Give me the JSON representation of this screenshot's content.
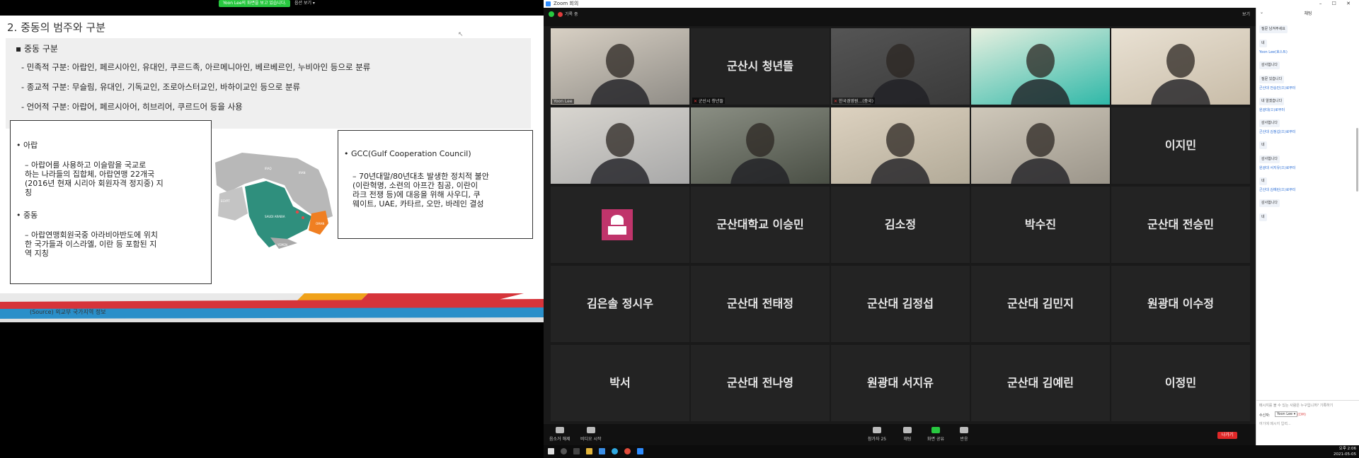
{
  "share_bar": {
    "sharing_text": "Yoon Lee의 화면을 보고 있습니다.",
    "view_options": "옵션 보기 ▾"
  },
  "slide": {
    "title": "2. 중동의 범주와 구분",
    "heading": "▪  중동 구분",
    "lines": [
      "- 민족적 구분: 아랍인, 페르시아인, 유대인, 쿠르드족, 아르메니아인, 베르베르인, 누비아인 등으로 분류",
      "- 종교적 구분: 무슬림, 유대인, 기독교인, 조로아스터교인, 바하이교인 등으로 분류",
      "- 언어적 구분:  아랍어, 페르시아어, 히브리어, 쿠르드어 등을 사용"
    ],
    "left_box": {
      "arab_title": "•  아랍",
      "arab_desc": [
        "– 아랍어를 사용하고 이슬람을 국교로",
        "하는 나라들의 집합체, 아랍연맹 22개국",
        "(2016년 현재 시리아 회원자격 정지중) 지",
        "칭"
      ],
      "me_title": "•  중동",
      "me_desc": [
        "– 아랍연맹회원국중 아라비아반도에 위치",
        "한 국가들과 이스라엘, 이란 등 포함된 지",
        "역 지칭"
      ]
    },
    "right_box": {
      "title": "•  GCC(Gulf Cooperation Council)",
      "desc": [
        "– 70년대말/80년대초 발생한 정치적 불안",
        "(이란혁명, 소련의 아프간 침공, 이란이",
        "라크 전쟁 등)에 대응을 위해 사우디, 쿠",
        "웨이트, UAE, 카타르, 오만, 바레인 결성"
      ]
    },
    "map_labels": {
      "turkey": "TURKEY",
      "iraq": "IRAQ",
      "iran": "IRAN",
      "egypt": "EGYPT",
      "saudi": "SAUDI ARABIA",
      "oman": "OMAN",
      "yemen": "YEMEN"
    },
    "source": "(Source) 외교부 국가지역 정보"
  },
  "zoom": {
    "window_title": "Zoom 회의",
    "window_controls": "–  ☐  ✕",
    "recording_label": "기록 중",
    "view_label": "보기",
    "tiles": [
      {
        "kind": "video",
        "label": "Yoon Lee"
      },
      {
        "kind": "name",
        "name": "군산시 청년뜰",
        "label": "군산시 청년뜰",
        "muted": true
      },
      {
        "kind": "video",
        "label": "한국경영원...(중국)",
        "muted": true
      },
      {
        "kind": "video",
        "label": "",
        "muted": true
      },
      {
        "kind": "video",
        "label": ""
      },
      {
        "kind": "video",
        "label": ""
      },
      {
        "kind": "video",
        "label": ""
      },
      {
        "kind": "video",
        "label": ""
      },
      {
        "kind": "video",
        "label": ""
      },
      {
        "kind": "name",
        "name": "이지민",
        "label": ""
      },
      {
        "kind": "avatar",
        "label": ""
      },
      {
        "kind": "name",
        "name": "군산대학교 이승민",
        "label": ""
      },
      {
        "kind": "name",
        "name": "김소정",
        "label": ""
      },
      {
        "kind": "name",
        "name": "박수진",
        "label": ""
      },
      {
        "kind": "name",
        "name": "군산대 전승민",
        "label": ""
      },
      {
        "kind": "name",
        "name": "김은솔 정시우",
        "label": ""
      },
      {
        "kind": "name",
        "name": "군산대 전태정",
        "label": ""
      },
      {
        "kind": "name",
        "name": "군산대 김정섭",
        "label": ""
      },
      {
        "kind": "name",
        "name": "군산대 김민지",
        "label": ""
      },
      {
        "kind": "name",
        "name": "원광대 이수정",
        "label": ""
      },
      {
        "kind": "name",
        "name": "박서",
        "label": ""
      },
      {
        "kind": "name",
        "name": "군산대 전나영",
        "label": ""
      },
      {
        "kind": "name",
        "name": "원광대 서지유",
        "label": ""
      },
      {
        "kind": "name",
        "name": "군산대 김예린",
        "label": ""
      },
      {
        "kind": "name",
        "name": "이정민",
        "label": ""
      }
    ],
    "toolbar": {
      "mute": "음소거 해제",
      "video": "비디오 시작",
      "participants": "참가자",
      "participants_count": "25",
      "chat": "채팅",
      "share": "화면 공유",
      "reactions": "반응",
      "leave": "나가기"
    },
    "chat": {
      "title": "채팅",
      "messages": [
        {
          "from": "",
          "text": "질문 남겨주세요"
        },
        {
          "from": "",
          "text": "네"
        },
        {
          "from": "Yoon Lee(호스트)",
          "text": "감사합니다"
        },
        {
          "from": "",
          "text": "질문 있습니다"
        },
        {
          "from": "군산대 전승민(으)로부터",
          "text": "네 알겠습니다"
        },
        {
          "from": "원광대(으)로부터",
          "text": "감사합니다"
        },
        {
          "from": "군산대 김정섭(으)로부터",
          "text": "네"
        },
        {
          "from": "",
          "text": "감사합니다"
        },
        {
          "from": "원광대 서지유(으)로부터",
          "text": "네"
        },
        {
          "from": "군산대 김예린(으)로부터",
          "text": "감사합니다"
        },
        {
          "from": "",
          "text": "네"
        }
      ],
      "hint": "메시지를 볼 수 있는 사람은 누구입니까? 기록하기",
      "to_label": "수신자:",
      "recipient": "Yoon Lee ▾",
      "dm_label": "(DM)",
      "input_placeholder": "여기에 메시지 입력..."
    },
    "clock": {
      "time": "오후 2:06",
      "date": "2021-05-05"
    }
  },
  "colors": {
    "zoom_blue": "#2d8cff",
    "active_border": "#d8e55a",
    "leave_red": "#e02828",
    "slide_bar_red": "#d6343a",
    "slide_bar_blue": "#2a8fc9",
    "slide_bar_orange": "#f0a21a"
  }
}
